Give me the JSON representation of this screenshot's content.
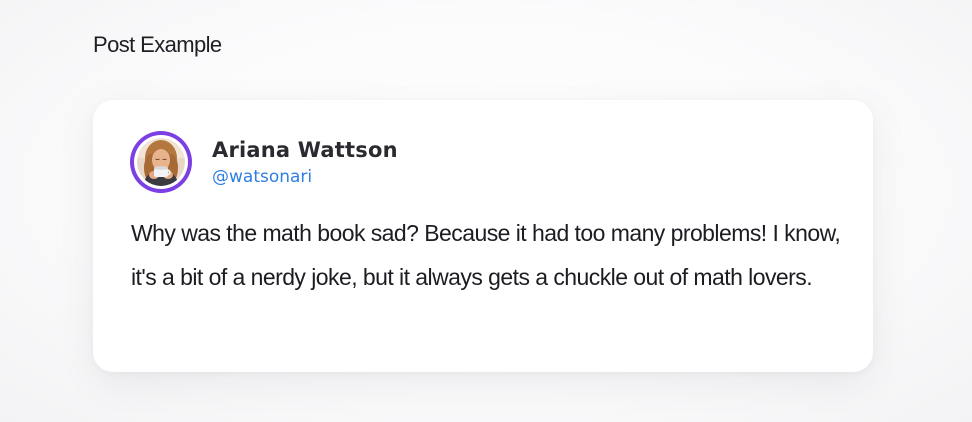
{
  "page": {
    "section_title": "Post Example"
  },
  "post": {
    "author": {
      "name": "Ariana Wattson",
      "handle": "@watsonari",
      "avatar_icon": "avatar-photo",
      "ring_color": "#7b3fe4"
    },
    "body": "Why was the math book sad? Because it had too many problems! I know, it's a bit of a nerdy joke, but it always gets a chuckle out of math lovers.",
    "handle_color": "#2f7fe0"
  }
}
